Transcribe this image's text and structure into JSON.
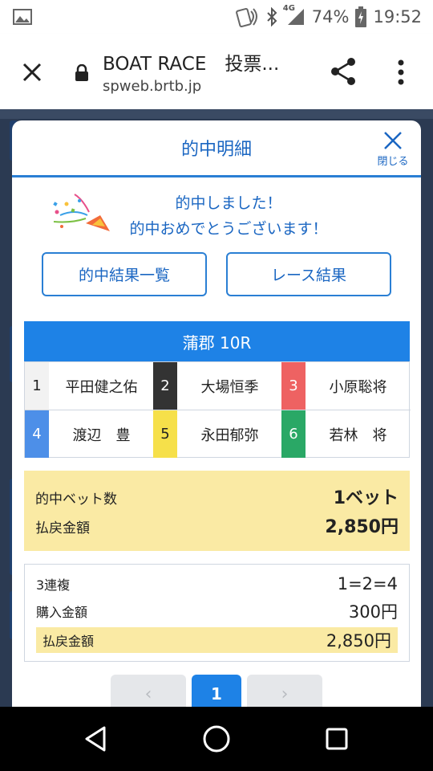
{
  "status_bar": {
    "network": "4G",
    "battery": "74%",
    "time": "19:52",
    "icons": [
      "image-icon",
      "nfc-icon",
      "bluetooth-icon",
      "signal-icon",
      "battery-charging-icon"
    ]
  },
  "browser": {
    "title": "BOAT RACE　投票...",
    "url": "spweb.brtb.jp",
    "icons": [
      "close-icon",
      "lock-icon",
      "share-icon",
      "more-vert-icon"
    ]
  },
  "modal": {
    "title": "的中明細",
    "close_label": "閉じる",
    "congrats_line1": "的中しました！",
    "congrats_line2": "的中おめでとうございます！",
    "congrats_icon": "party-popper-icon",
    "button_results_list": "的中結果一覧",
    "button_race_results": "レース結果",
    "race_title": "蒲郡 10R",
    "racers": [
      {
        "num": "1",
        "name": "平田健之佑",
        "color": "#f2f2f2",
        "text_color": "#222222"
      },
      {
        "num": "2",
        "name": "大場恒季",
        "color": "#333333",
        "text_color": "#ffffff"
      },
      {
        "num": "3",
        "name": "小原聡将",
        "color": "#ee6262",
        "text_color": "#ffffff"
      },
      {
        "num": "4",
        "name": "渡辺　豊",
        "color": "#4d8fe8",
        "text_color": "#ffffff"
      },
      {
        "num": "5",
        "name": "永田郁弥",
        "color": "#f6e04a",
        "text_color": "#222222"
      },
      {
        "num": "6",
        "name": "若林　将",
        "color": "#2aa866",
        "text_color": "#ffffff"
      }
    ],
    "summary": {
      "hit_bets_label": "的中ベット数",
      "hit_bets_value": "1ベット",
      "payout_label": "払戻金額",
      "payout_value": "2,850円"
    },
    "detail": {
      "bet_type": "3連複",
      "combination": "1=2=4",
      "purchase_label": "購入金額",
      "purchase_value": "300円",
      "payout_label": "払戻金額",
      "payout_value": "2,850円"
    },
    "pager": {
      "prev": "‹",
      "current": "1",
      "next": "›"
    }
  },
  "colors": {
    "accent": "#1e82e6",
    "highlight": "#faeaa4",
    "backdrop": "#2b3a52"
  },
  "navbar": {
    "icons": [
      "back-icon",
      "home-icon",
      "recents-icon"
    ]
  }
}
